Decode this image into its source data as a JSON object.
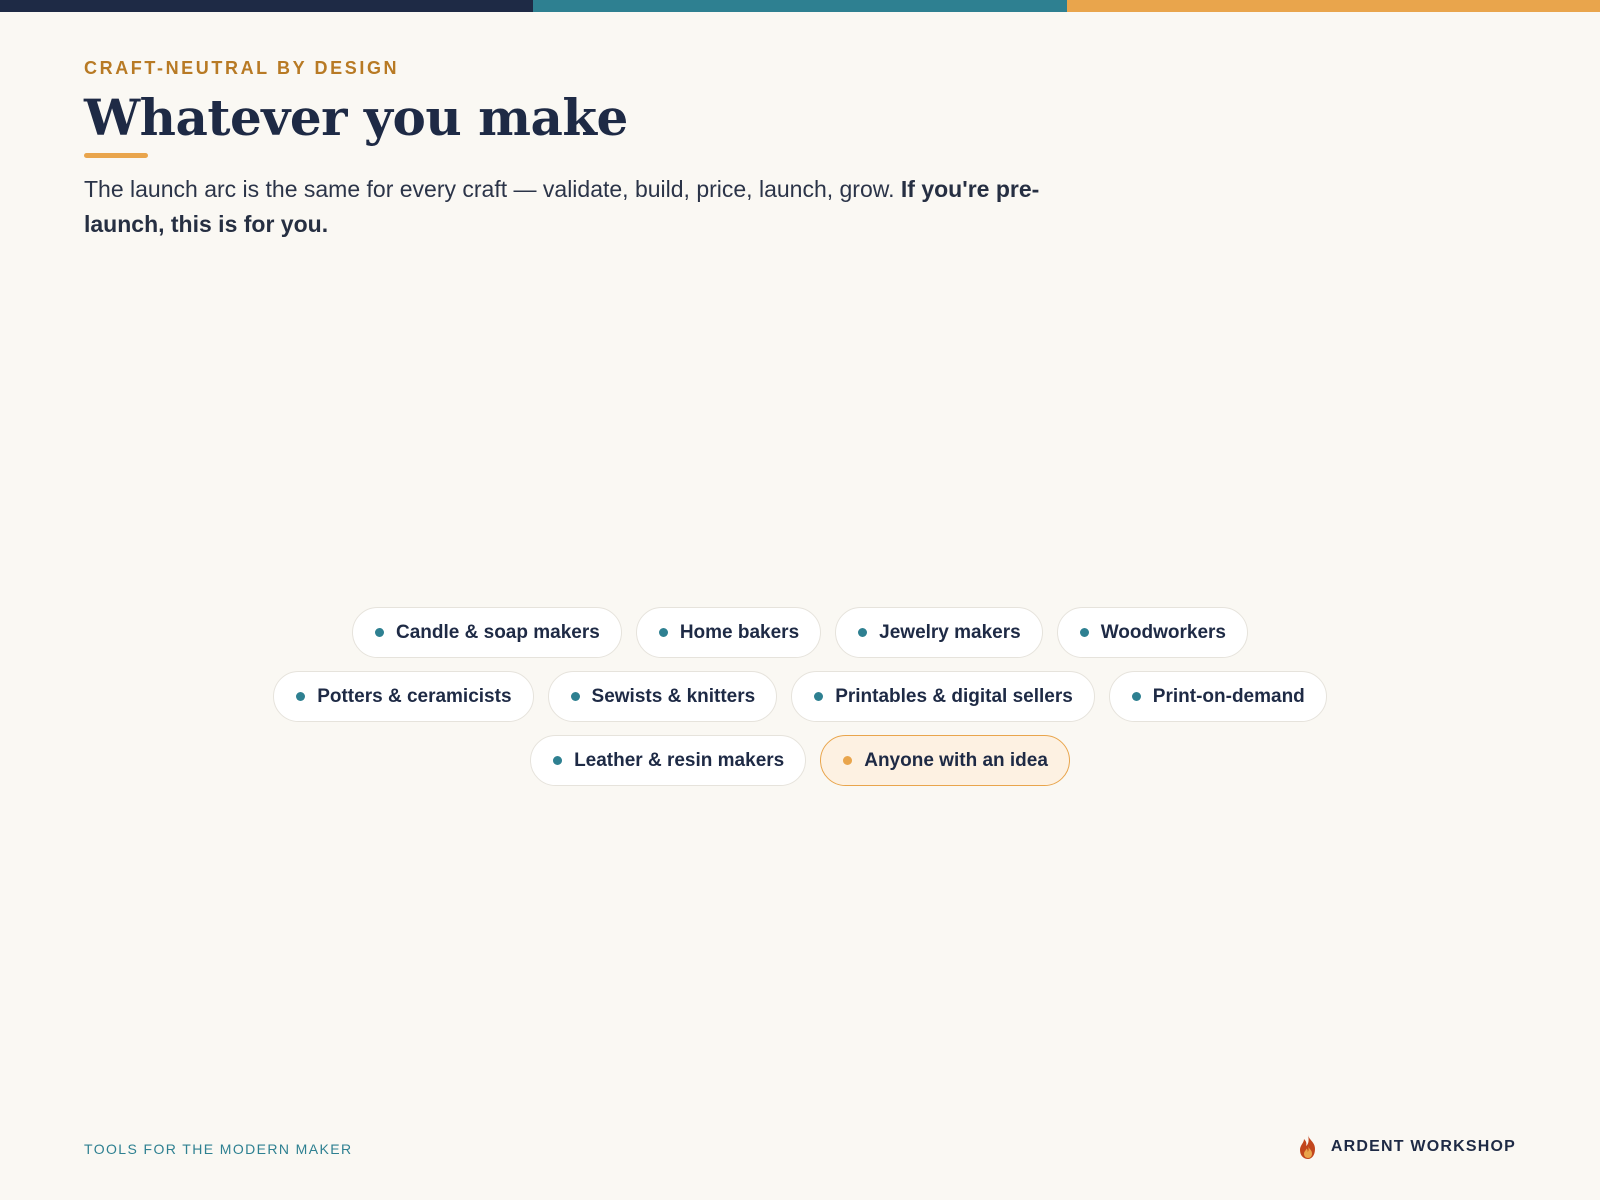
{
  "colors": {
    "navy": "#1e2a45",
    "teal": "#2e8091",
    "orange": "#e9a54c",
    "eyebrow": "#b87a24",
    "background": "#faf8f3"
  },
  "topbar": [
    "#1e2a45",
    "#2e8091",
    "#e9a54c"
  ],
  "header": {
    "eyebrow": "CRAFT-NEUTRAL BY DESIGN",
    "title": "Whatever you make",
    "lead": "The launch arc is the same for every craft — validate, build, price, launch, grow.",
    "lead_bold": "If you're pre-launch, this is for you."
  },
  "chips": {
    "row1": [
      {
        "label": "Candle & soap makers"
      },
      {
        "label": "Home bakers"
      },
      {
        "label": "Jewelry makers"
      },
      {
        "label": "Woodworkers"
      }
    ],
    "row2": [
      {
        "label": "Potters & ceramicists"
      },
      {
        "label": "Sewists & knitters"
      },
      {
        "label": "Printables & digital sellers"
      },
      {
        "label": "Print-on-demand"
      }
    ],
    "row3": [
      {
        "label": "Leather & resin makers"
      },
      {
        "label": "Anyone with an idea"
      }
    ]
  },
  "footer": {
    "tagline": "TOOLS FOR THE MODERN MAKER",
    "brand": "ARDENT WORKSHOP",
    "brand_icon": "flame-icon"
  }
}
